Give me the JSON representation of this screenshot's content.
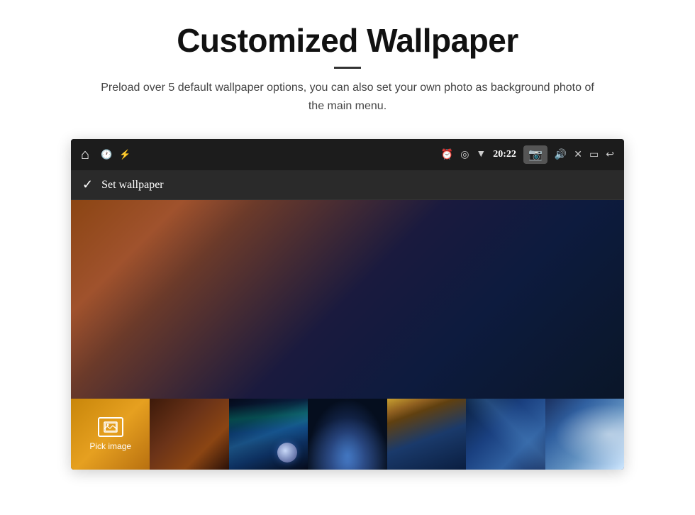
{
  "page": {
    "title": "Customized Wallpaper",
    "subtitle": "Preload over 5 default wallpaper options, you can also set your own photo as background photo of the main menu.",
    "divider": true
  },
  "device": {
    "statusBar": {
      "time": "20:22",
      "leftIcons": [
        "home",
        "clock",
        "usb"
      ],
      "rightIcons": [
        "alarm",
        "location",
        "wifi",
        "camera",
        "volume",
        "close",
        "window",
        "back"
      ]
    },
    "wallpaperHeader": {
      "checkLabel": "✓",
      "title": "Set wallpaper"
    },
    "thumbnails": [
      {
        "id": "pick",
        "label": "Pick image"
      },
      {
        "id": "brown-space",
        "label": ""
      },
      {
        "id": "northern-lights",
        "label": ""
      },
      {
        "id": "planet",
        "label": ""
      },
      {
        "id": "wave",
        "label": ""
      },
      {
        "id": "blue-abstract",
        "label": ""
      },
      {
        "id": "light-ray",
        "label": ""
      }
    ]
  }
}
